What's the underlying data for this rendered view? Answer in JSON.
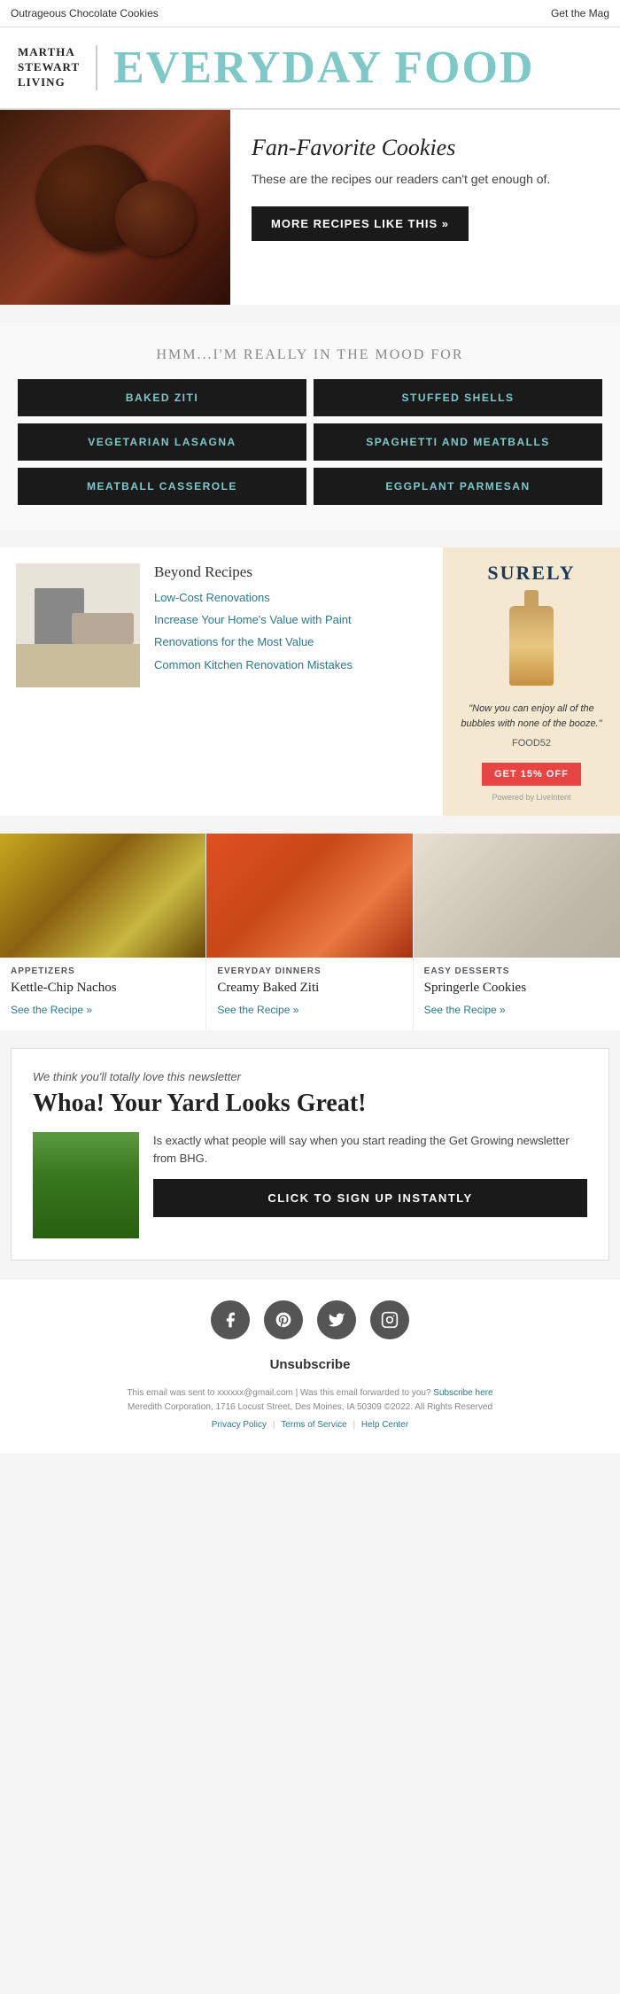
{
  "topbar": {
    "left_link": "Outrageous Chocolate Cookies",
    "right_link": "Get the Mag"
  },
  "header": {
    "brand_line1": "MARTHA",
    "brand_line2": "STEWART",
    "brand_line3": "LIVING",
    "title": "EVERYDAY FOOD"
  },
  "hero": {
    "title": "Fan-Favorite Cookies",
    "description": "These are the recipes our readers can't get enough of.",
    "button_label": "MORE RECIPES LIKE THIS »"
  },
  "mood": {
    "title": "HMM...I'M REALLY IN THE MOOD FOR",
    "items": [
      "BAKED ZITI",
      "STUFFED SHELLS",
      "VEGETARIAN LASAGNA",
      "SPAGHETTI AND MEATBALLS",
      "MEATBALL CASSEROLE",
      "EGGPLANT PARMESAN"
    ]
  },
  "beyond": {
    "title": "Beyond Recipes",
    "links": [
      "Low-Cost Renovations",
      "Increase Your Home's Value with Paint",
      "Renovations for the Most Value",
      "Common Kitchen Renovation Mistakes"
    ]
  },
  "ad": {
    "brand": "SURELY",
    "quote": "\"Now you can enjoy all of the bubbles with none of the booze.\"",
    "source": "FOOD52",
    "cta": "GET 15% OFF",
    "powered_by": "Powered by LiveIntent"
  },
  "recipes": [
    {
      "category": "APPETIZERS",
      "name": "Kettle-Chip Nachos",
      "link": "See the Recipe »"
    },
    {
      "category": "EVERYDAY DINNERS",
      "name": "Creamy Baked Ziti",
      "link": "See the Recipe »"
    },
    {
      "category": "EASY DESSERTS",
      "name": "Springerle Cookies",
      "link": "See the Recipe »"
    }
  ],
  "newsletter": {
    "intro": "We think you'll totally love this newsletter",
    "headline": "Whoa! Your Yard Looks Great!",
    "description": "Is exactly what people will say when you start reading the Get Growing newsletter from BHG.",
    "button_label": "CLICK TO SIGN UP INSTANTLY"
  },
  "social": {
    "icons": [
      {
        "name": "facebook-icon",
        "symbol": "f"
      },
      {
        "name": "pinterest-icon",
        "symbol": "p"
      },
      {
        "name": "twitter-icon",
        "symbol": "t"
      },
      {
        "name": "instagram-icon",
        "symbol": "i"
      }
    ],
    "unsubscribe_label": "Unsubscribe",
    "legal_line1": "This email was sent to xxxxxx@gmail.com  |  Was this email forwarded to you?",
    "subscribe_here": "Subscribe here",
    "legal_line2": "Meredith Corporation, 1716 Locust Street, Des Moines, IA 50309 ©2022. All Rights Reserved",
    "footer_links": [
      "Privacy Policy",
      "Terms of Service",
      "Help Center"
    ]
  }
}
